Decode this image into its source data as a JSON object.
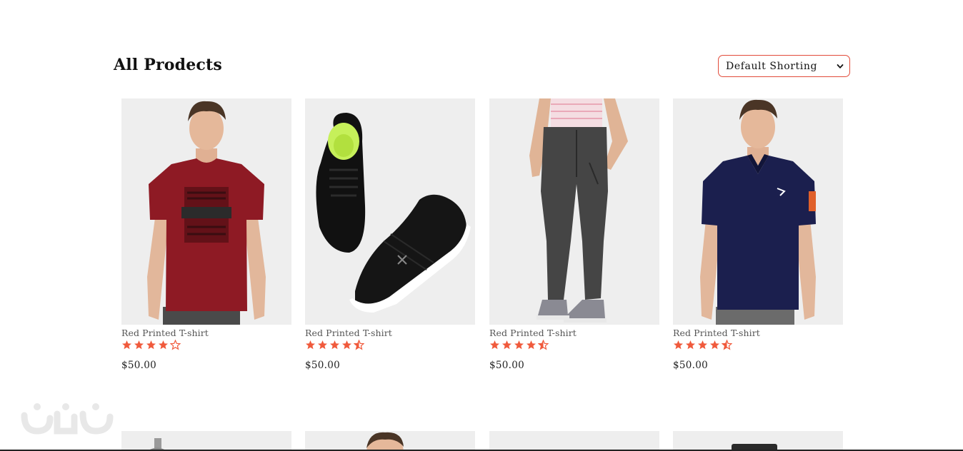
{
  "section": {
    "title": "All Prodects"
  },
  "sort": {
    "selected": "Default Shorting"
  },
  "products": [
    {
      "name": "Red Printed T-shirt",
      "rating": 4,
      "price": "$50.00",
      "image": "man-red-tshirt"
    },
    {
      "name": "Red Printed T-shirt",
      "rating": 4.5,
      "price": "$50.00",
      "image": "black-sneakers"
    },
    {
      "name": "Red Printed T-shirt",
      "rating": 4.5,
      "price": "$50.00",
      "image": "grey-joggers"
    },
    {
      "name": "Red Printed T-shirt",
      "rating": 4.5,
      "price": "$50.00",
      "image": "man-navy-polo"
    }
  ],
  "colors": {
    "accent": "#e24b3a",
    "star": "#f05a3c",
    "thumb_bg": "#eeeeee"
  }
}
